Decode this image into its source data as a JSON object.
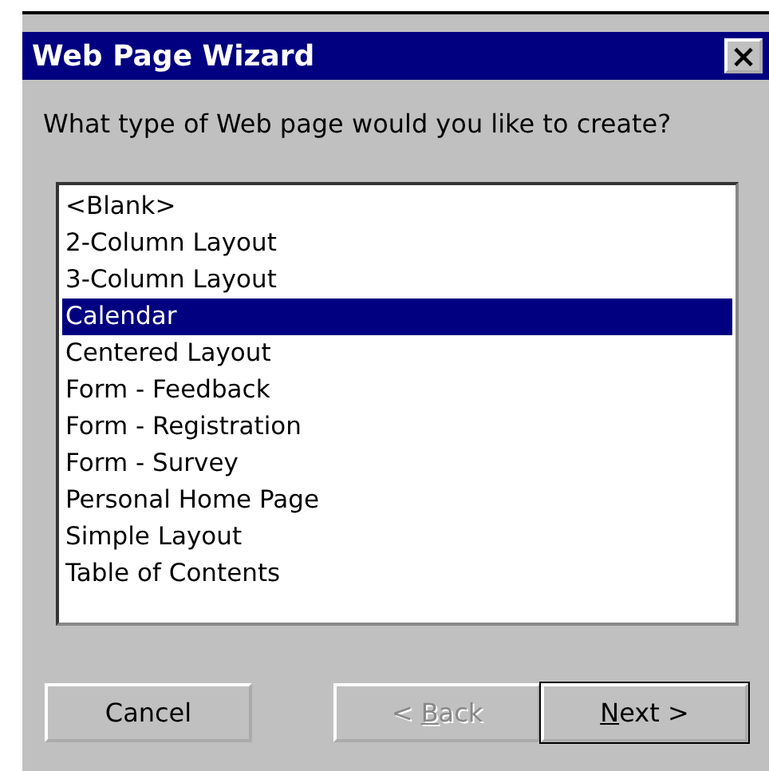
{
  "window": {
    "title": "Web Page Wizard",
    "close": "×"
  },
  "prompt": "What type of Web page would you like to create?",
  "list": [
    {
      "label": "<Blank>",
      "selected": false
    },
    {
      "label": "2-Column Layout",
      "selected": false
    },
    {
      "label": "3-Column Layout",
      "selected": false
    },
    {
      "label": "Calendar",
      "selected": true
    },
    {
      "label": "Centered Layout",
      "selected": false
    },
    {
      "label": "Form - Feedback",
      "selected": false
    },
    {
      "label": "Form - Registration",
      "selected": false
    },
    {
      "label": "Form - Survey",
      "selected": false
    },
    {
      "label": "Personal Home Page",
      "selected": false
    },
    {
      "label": "Simple Layout",
      "selected": false
    },
    {
      "label": "Table of Contents",
      "selected": false
    }
  ],
  "buttons": [
    {
      "label": "Cancel",
      "disabled": false,
      "default": false,
      "mnemonic": false,
      "kind": "cancel"
    },
    {
      "label": "< Back",
      "disabled": true,
      "default": false,
      "mnemonic": true,
      "kind": "back"
    },
    {
      "label": "Next >",
      "disabled": false,
      "default": true,
      "mnemonic": true,
      "kind": "next"
    }
  ]
}
